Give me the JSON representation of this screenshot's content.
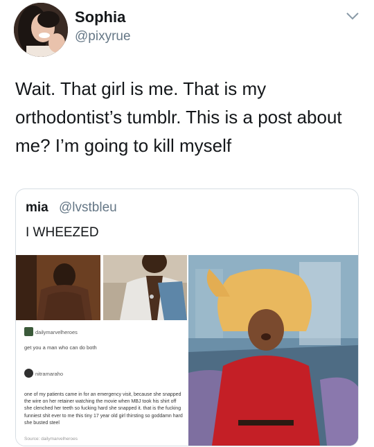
{
  "author": {
    "name": "Sophia",
    "handle": "@pixyrue"
  },
  "tweet": {
    "text": "Wait. That girl is me. That is my orthodontist’s tumblr. This is a post about me? I’m going to kill myself"
  },
  "quoted": {
    "name": "mia",
    "handle": "@lvstbleu",
    "text": "I WHEEZED",
    "tumblr": {
      "user1": "dailymarvelheroes",
      "post1": "get you a man who can do both",
      "user2": "nitramaraho",
      "post2": "one of my patients came in for an emergency visit, because she snapped the wire on her retainer watching the movie when MBJ took his shirt off she clenched her teeth so fucking hard she snapped it. that is the fucking funniest shit ever to me this tiny 17 year old girl thirsting so goddamn hard she busted steel",
      "source": "Source: dailymarvelheroes"
    }
  },
  "icons": {
    "menu": "chevron-down-icon",
    "avatar": "profile-photo"
  },
  "colors": {
    "text": "#14171a",
    "secondary": "#657786",
    "border": "#d6dde3"
  }
}
